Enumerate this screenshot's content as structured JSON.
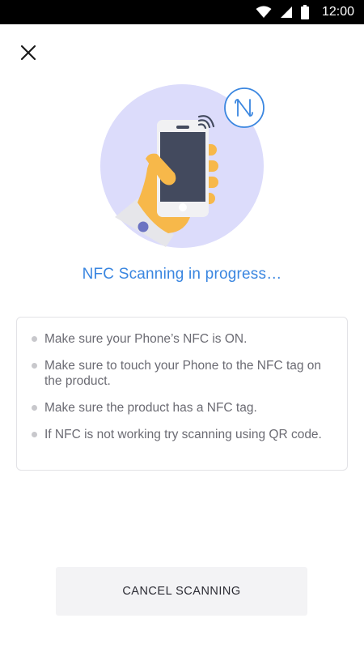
{
  "status_bar": {
    "time": "12:00",
    "icons": [
      "wifi-icon",
      "cell-signal-icon",
      "battery-icon"
    ]
  },
  "close_icon": "close-icon",
  "illustration": {
    "icons": [
      "nfc-badge-icon",
      "phone-in-hand-illustration"
    ],
    "colors": {
      "circle": "#dcdcfb",
      "phone": "#434a5e",
      "hand": "#f7b84a",
      "nfc_badge": "#3a86e0"
    }
  },
  "headline": "NFC Scanning in progress…",
  "tips": [
    "Make sure your Phone’s NFC is ON.",
    "Make sure  to touch your Phone  to the NFC tag on the product.",
    "Make sure the product has a NFC tag.",
    "If NFC is not working try scanning using QR code."
  ],
  "cancel_button": "CANCEL SCANNING",
  "colors": {
    "accent": "#3a86e0",
    "tip_text": "#6b6b73",
    "button_bg": "#f3f3f5"
  }
}
